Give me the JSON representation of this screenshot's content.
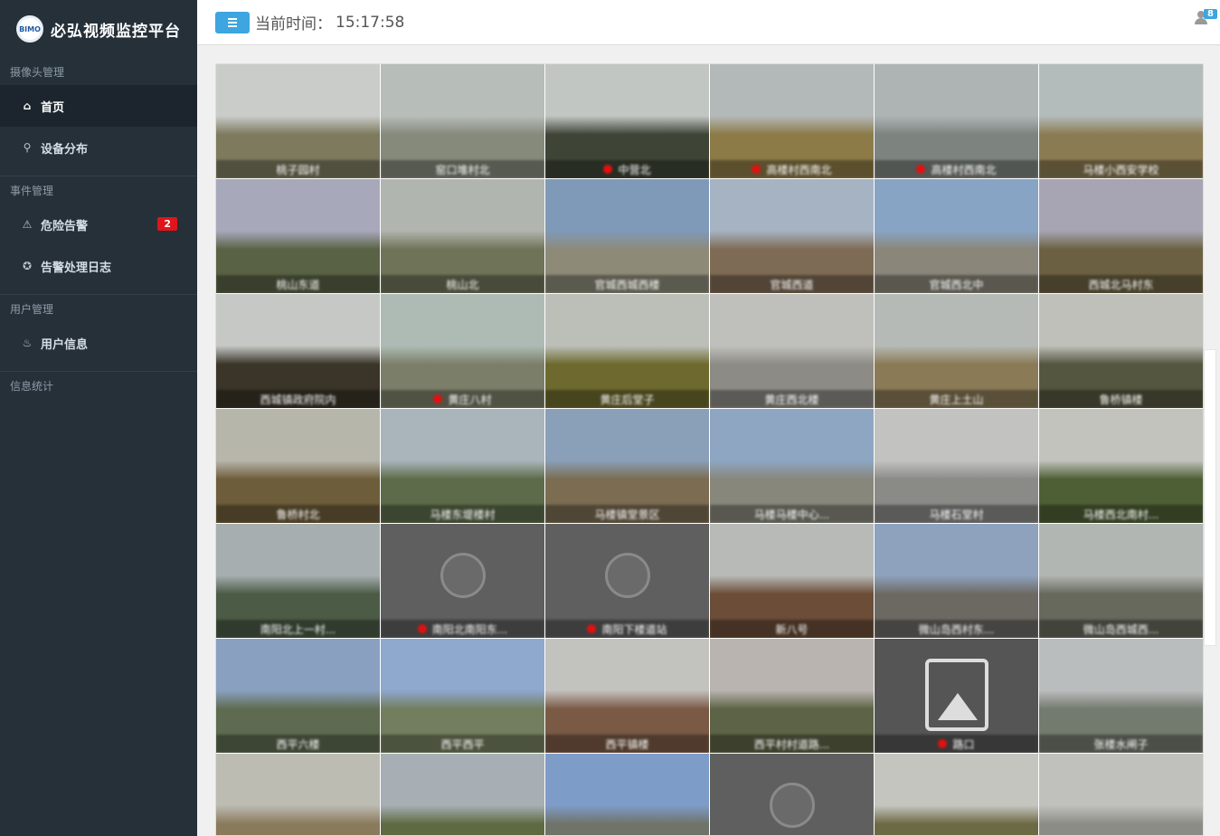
{
  "app": {
    "title": "必弘视频监控平台",
    "logo_text": "BIMO"
  },
  "sidebar": {
    "sections": [
      {
        "label": "摄像头管理",
        "items": [
          {
            "label": "首页",
            "icon": "home-icon",
            "active": true
          },
          {
            "label": "设备分布",
            "icon": "map-marker-icon",
            "active": false
          }
        ]
      },
      {
        "label": "事件管理",
        "items": [
          {
            "label": "危险告警",
            "icon": "warning-icon",
            "badge": "2"
          },
          {
            "label": "告警处理日志",
            "icon": "gear-icon"
          }
        ]
      },
      {
        "label": "用户管理",
        "items": [
          {
            "label": "用户信息",
            "icon": "fire-icon"
          }
        ]
      },
      {
        "label": "信息统计",
        "items": []
      }
    ]
  },
  "header": {
    "time_label": "当前时间：",
    "time_value": "15:17:58",
    "user_badge": "8"
  },
  "cameras": [
    {
      "name": "桃子园村",
      "alert": false,
      "type": "video",
      "sky": "#c9ccc9",
      "land": "#7d7a5e"
    },
    {
      "name": "窑口堆村北",
      "alert": false,
      "type": "video",
      "sky": "#b7bdb8",
      "land": "#858a7b"
    },
    {
      "name": "中营北",
      "alert": true,
      "type": "video",
      "sky": "#c2c6c3",
      "land": "#3e4537"
    },
    {
      "name": "高楼村西南北",
      "alert": true,
      "type": "video",
      "sky": "#b3b9b9",
      "land": "#8c7a47"
    },
    {
      "name": "高楼村西南北",
      "alert": true,
      "type": "video",
      "sky": "#aeb4b4",
      "land": "#7d847f"
    },
    {
      "name": "马楼小西安学校",
      "alert": false,
      "type": "video",
      "sky": "#b4bbbb",
      "land": "#8b7b52"
    },
    {
      "name": "桃山东道",
      "alert": false,
      "type": "video",
      "sky": "#a7a9bb",
      "land": "#5a6245"
    },
    {
      "name": "桃山北",
      "alert": false,
      "type": "video",
      "sky": "#b0b5af",
      "land": "#6f7358"
    },
    {
      "name": "官城西城西楼",
      "alert": false,
      "type": "video",
      "sky": "#7f9ab8",
      "land": "#8d8a78"
    },
    {
      "name": "官城西道",
      "alert": false,
      "type": "video",
      "sky": "#a6b3c2",
      "land": "#7e6b55"
    },
    {
      "name": "官城西北中",
      "alert": false,
      "type": "video",
      "sky": "#88a4c4",
      "land": "#8a8679"
    },
    {
      "name": "西城北马村东",
      "alert": false,
      "type": "video",
      "sky": "#a7a4b3",
      "land": "#6b6142"
    },
    {
      "name": "西城镇政府院内",
      "alert": false,
      "type": "video",
      "sky": "#c6c8c6",
      "land": "#3a3528"
    },
    {
      "name": "黄庄八村",
      "alert": true,
      "type": "video",
      "sky": "#aebbb4",
      "land": "#7b7f69"
    },
    {
      "name": "黄庄后堂子",
      "alert": false,
      "type": "video",
      "sky": "#bcbfb7",
      "land": "#6e6a2f"
    },
    {
      "name": "黄庄西北楼",
      "alert": false,
      "type": "video",
      "sky": "#bfbfbb",
      "land": "#8d8b85"
    },
    {
      "name": "黄庄上土山",
      "alert": false,
      "type": "video",
      "sky": "#b6bab6",
      "land": "#8a7a56"
    },
    {
      "name": "鲁桥镇楼",
      "alert": false,
      "type": "video",
      "sky": "#bfc0ba",
      "land": "#55563f"
    },
    {
      "name": "鲁桥村北",
      "alert": false,
      "type": "video",
      "sky": "#b7b6ab",
      "land": "#6e5d3a"
    },
    {
      "name": "马楼东堤楼村",
      "alert": false,
      "type": "video",
      "sky": "#a9b5bb",
      "land": "#5d6b4a"
    },
    {
      "name": "马楼镇堂景区",
      "alert": false,
      "type": "video",
      "sky": "#8a9fb8",
      "land": "#7b6c52"
    },
    {
      "name": "马楼马楼中心...",
      "alert": false,
      "type": "video",
      "sky": "#8ea6c2",
      "land": "#87877c"
    },
    {
      "name": "马楼石堂村",
      "alert": false,
      "type": "video",
      "sky": "#c2c3c1",
      "land": "#8a8a87"
    },
    {
      "name": "马楼西北南村...",
      "alert": false,
      "type": "video",
      "sky": "#c1c3bc",
      "land": "#4e5f35"
    },
    {
      "name": "南阳北上一村...",
      "alert": false,
      "type": "video",
      "sky": "#a6aeb0",
      "land": "#4b5b45"
    },
    {
      "name": "南阳北南阳东...",
      "alert": true,
      "type": "offline",
      "sky": "",
      "land": ""
    },
    {
      "name": "南阳下楼道站",
      "alert": true,
      "type": "offline",
      "sky": "",
      "land": ""
    },
    {
      "name": "新八号",
      "alert": false,
      "type": "video",
      "sky": "#b7bab7",
      "land": "#6b4d38"
    },
    {
      "name": "微山岛西村东...",
      "alert": false,
      "type": "video",
      "sky": "#8ea2bd",
      "land": "#6c6963"
    },
    {
      "name": "微山岛西城西...",
      "alert": false,
      "type": "video",
      "sky": "#b2b6b3",
      "land": "#66695c"
    },
    {
      "name": "西平六楼",
      "alert": false,
      "type": "video",
      "sky": "#8aa0c0",
      "land": "#5e6b50"
    },
    {
      "name": "西平西平",
      "alert": false,
      "type": "video",
      "sky": "#8ea8ce",
      "land": "#737e5e"
    },
    {
      "name": "西平镇楼",
      "alert": false,
      "type": "video",
      "sky": "#c2c2bf",
      "land": "#7a5a45"
    },
    {
      "name": "西平村村道路...",
      "alert": false,
      "type": "video",
      "sky": "#b9b4b0",
      "land": "#5d6346"
    },
    {
      "name": "路口",
      "alert": true,
      "type": "noimg",
      "sky": "",
      "land": ""
    },
    {
      "name": "张楼水闸子",
      "alert": false,
      "type": "video",
      "sky": "#babdbd",
      "land": "#737a6e"
    },
    {
      "name": "",
      "alert": false,
      "type": "video",
      "sky": "#bcbcb3",
      "land": "#8a7a5c"
    },
    {
      "name": "",
      "alert": false,
      "type": "video",
      "sky": "#a7afb4",
      "land": "#5e6b42"
    },
    {
      "name": "",
      "alert": false,
      "type": "video",
      "sky": "#7e9cc8",
      "land": "#6f7369"
    },
    {
      "name": "",
      "alert": false,
      "type": "offline",
      "sky": "",
      "land": ""
    },
    {
      "name": "",
      "alert": false,
      "type": "video",
      "sky": "#c5c5c0",
      "land": "#6c6a44"
    },
    {
      "name": "",
      "alert": false,
      "type": "video",
      "sky": "#c0c1bd",
      "land": "#8c8c86"
    }
  ]
}
